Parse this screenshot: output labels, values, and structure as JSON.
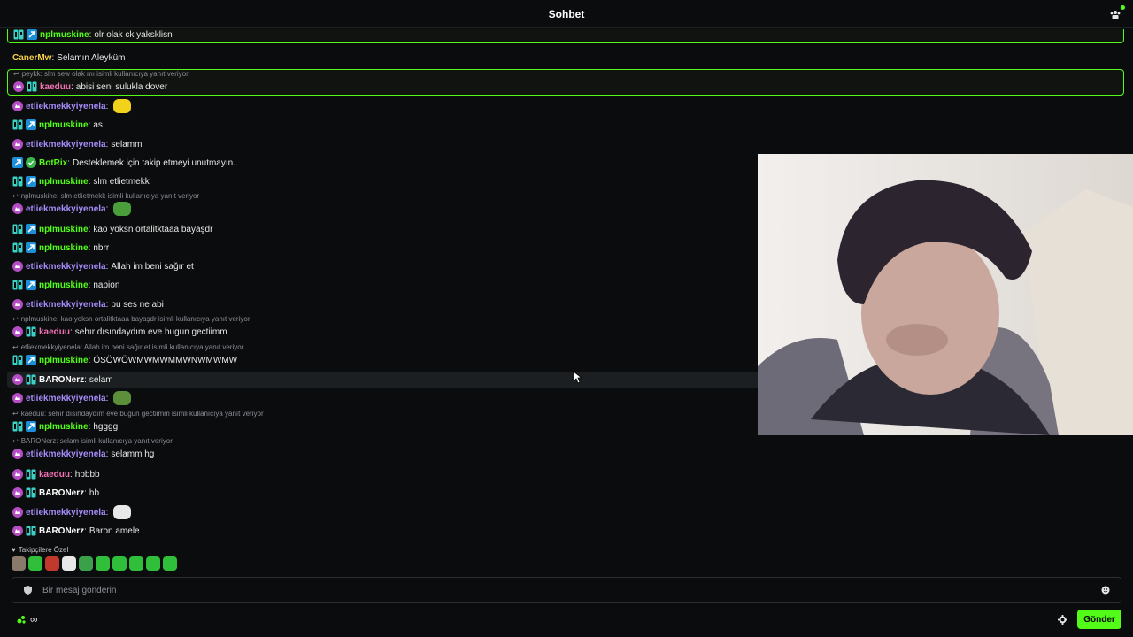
{
  "header": {
    "title": "Sohbet"
  },
  "colors": {
    "accent": "#53fc18",
    "npl": "#53fc18",
    "purple": "#a78bfa",
    "pink": "#f472b6",
    "white": "#ffffff"
  },
  "messages": [
    {
      "reply": "",
      "badges": [
        "og",
        "vip"
      ],
      "user": "nplmuskine",
      "color": "#53fc18",
      "sep": ":",
      "text": "olr olak ck yaksklisn",
      "boxed": true
    },
    {
      "reply": "",
      "badges": [],
      "user": "CanerMw",
      "color": "#f7d046",
      "sep": ":",
      "text": "Selamın Aleyküm"
    },
    {
      "reply": "peykk: slm sew olak mı isimli kullanıcıya yanıt veriyor",
      "badges": [
        "sub",
        "og"
      ],
      "user": "kaeduu",
      "color": "#f472b6",
      "sep": ":",
      "text": "abisi seni sulukla dover",
      "boxed": true
    },
    {
      "reply": "",
      "badges": [
        "sub"
      ],
      "user": "etliekmekkyiyenela",
      "color": "#a78bfa",
      "sep": ":",
      "text": "",
      "emote": "yellow-face-emote"
    },
    {
      "reply": "",
      "badges": [
        "og",
        "vip"
      ],
      "user": "nplmuskine",
      "color": "#53fc18",
      "sep": ":",
      "text": "as"
    },
    {
      "reply": "",
      "badges": [
        "sub"
      ],
      "user": "etliekmekkyiyenela",
      "color": "#a78bfa",
      "sep": ":",
      "text": "selamm"
    },
    {
      "reply": "",
      "badges": [
        "vip",
        "verified"
      ],
      "user": "BotRix",
      "color": "#53fc18",
      "sep": ":",
      "text": "Desteklemek için takip etmeyi unutmayın.."
    },
    {
      "reply": "",
      "badges": [
        "og",
        "vip"
      ],
      "user": "nplmuskine",
      "color": "#53fc18",
      "sep": ":",
      "text": "slm etlietmekk"
    },
    {
      "reply": "nplmuskine: slm etlietmekk isimli kullanıcıya yanıt veriyor",
      "badges": [
        "sub"
      ],
      "user": "etliekmekkyiyenela",
      "color": "#a78bfa",
      "sep": ":",
      "text": "",
      "emote": "pepe-hat-emote"
    },
    {
      "reply": "",
      "badges": [
        "og",
        "vip"
      ],
      "user": "nplmuskine",
      "color": "#53fc18",
      "sep": ":",
      "text": "kao yoksn ortalitktaaa bayaşdr"
    },
    {
      "reply": "",
      "badges": [
        "og",
        "vip"
      ],
      "user": "nplmuskine",
      "color": "#53fc18",
      "sep": ":",
      "text": "nbrr"
    },
    {
      "reply": "",
      "badges": [
        "sub"
      ],
      "user": "etliekmekkyiyenela",
      "color": "#a78bfa",
      "sep": ":",
      "text": "Allah im beni sağır et"
    },
    {
      "reply": "",
      "badges": [
        "og",
        "vip"
      ],
      "user": "nplmuskine",
      "color": "#53fc18",
      "sep": ":",
      "text": "napion"
    },
    {
      "reply": "",
      "badges": [
        "sub"
      ],
      "user": "etliekmekkyiyenela",
      "color": "#a78bfa",
      "sep": ":",
      "text": "bu ses ne abi"
    },
    {
      "reply": "nplmuskine: kao yoksn ortalitktaaa bayaşdr isimli kullanıcıya yanıt veriyor",
      "badges": [
        "sub",
        "og"
      ],
      "user": "kaeduu",
      "color": "#f472b6",
      "sep": ":",
      "text": "sehır dısındaydım eve bugun gectiimm"
    },
    {
      "reply": "etliekmekkyiyenela: Allah im beni sağır et isimli kullanıcıya yanıt veriyor",
      "badges": [
        "og",
        "vip"
      ],
      "user": "nplmuskine",
      "color": "#53fc18",
      "sep": ":",
      "text": "ÖSÖWÖWMWMWMMWNWMWMW"
    },
    {
      "reply": "",
      "badges": [
        "sub",
        "og"
      ],
      "user": "BARONerz",
      "color": "#ffffff",
      "sep": ":",
      "text": "selam",
      "hover": true
    },
    {
      "reply": "",
      "badges": [
        "sub"
      ],
      "user": "etliekmekkyiyenela",
      "color": "#a78bfa",
      "sep": ":",
      "text": "",
      "emote": "pepe-lying-emote"
    },
    {
      "reply": "kaeduu: sehır dısındaydım eve bugun gectiimm isimli kullanıcıya yanıt veriyor",
      "badges": [
        "og",
        "vip"
      ],
      "user": "nplmuskine",
      "color": "#53fc18",
      "sep": ":",
      "text": "hgggg"
    },
    {
      "reply": "BARONerz: selam isimli kullanıcıya yanıt veriyor",
      "badges": [
        "sub"
      ],
      "user": "etliekmekkyiyenela",
      "color": "#a78bfa",
      "sep": ":",
      "text": "selamm hg"
    },
    {
      "reply": "",
      "badges": [
        "sub",
        "og"
      ],
      "user": "kaeduu",
      "color": "#f472b6",
      "sep": ":",
      "text": "hbbbb"
    },
    {
      "reply": "",
      "badges": [
        "sub",
        "og"
      ],
      "user": "BARONerz",
      "color": "#ffffff",
      "sep": ":",
      "text": "hb"
    },
    {
      "reply": "",
      "badges": [
        "sub"
      ],
      "user": "etliekmekkyiyenela",
      "color": "#a78bfa",
      "sep": ":",
      "text": "",
      "emote": "chicken-emote"
    },
    {
      "reply": "",
      "badges": [
        "sub",
        "og"
      ],
      "user": "BARONerz",
      "color": "#ffffff",
      "sep": ":",
      "text": "Baron amele"
    }
  ],
  "follower_emotes": {
    "label": "Takipçilere Özel",
    "items": [
      "portrait-emote",
      "green-blob-emote",
      "red-devil-emote",
      "panda-emote",
      "green-mail-emote",
      "green-face-emote",
      "green-chat-emote",
      "green-cap-emote",
      "green-wink-emote",
      "green-smile-emote"
    ]
  },
  "input": {
    "placeholder": "Bir mesaj gönderin"
  },
  "footer": {
    "count": "∞",
    "send_label": "Gönder"
  }
}
